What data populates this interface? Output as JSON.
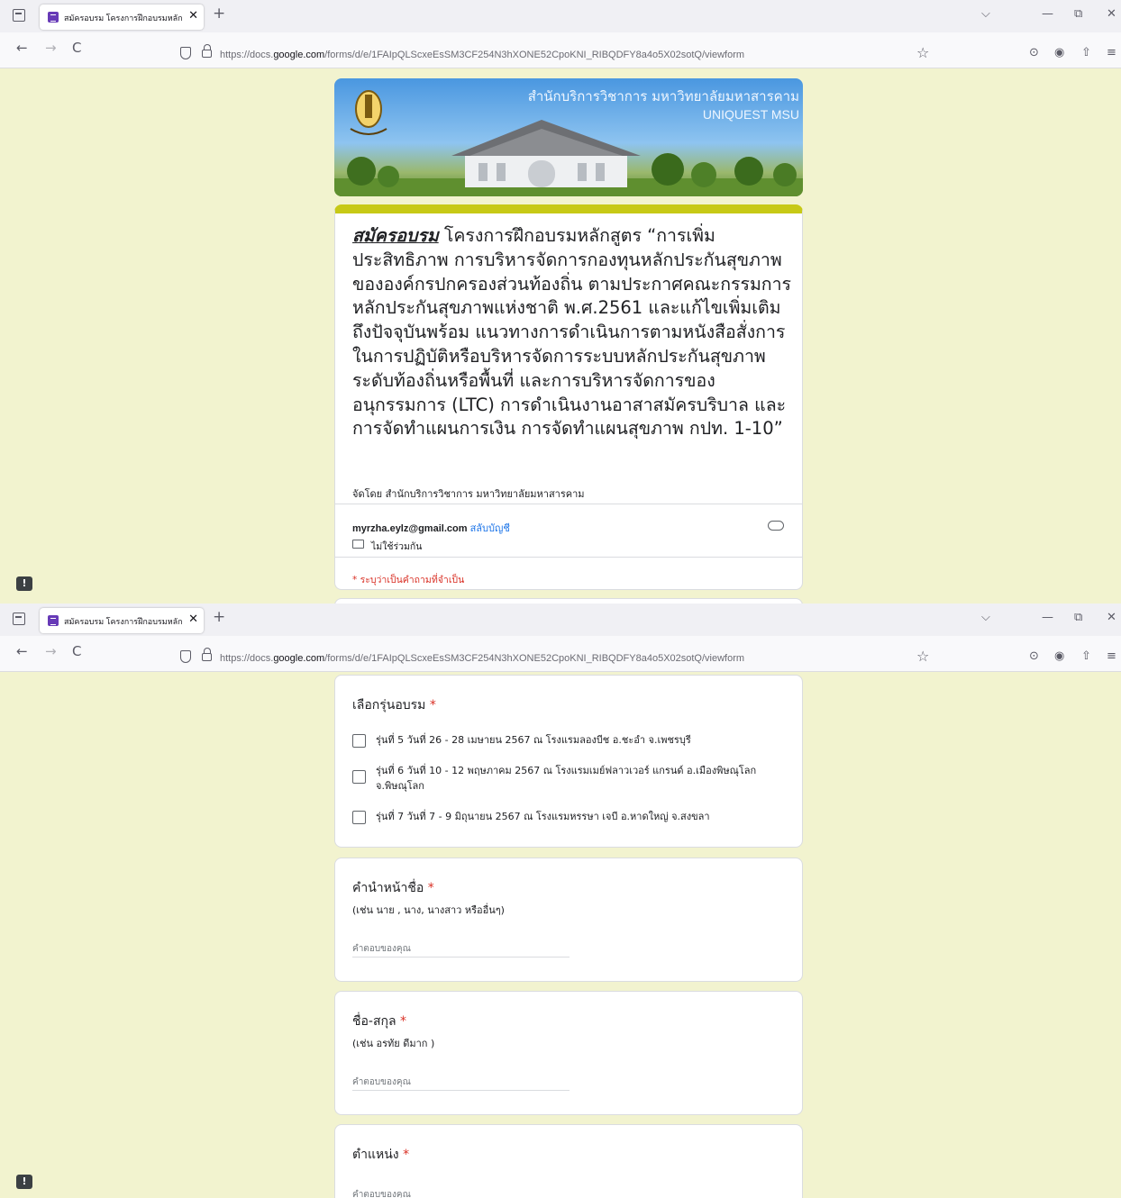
{
  "browser": {
    "tab_title": "สมัครอบรม โครงการฝึกอบรมหลักสู",
    "tab_close": "✕",
    "new_tab": "+",
    "url_prefix": "https://docs.",
    "url_host": "google.com",
    "url_path": "/forms/d/e/1FAIpQLScxeEsSM3CF254N3hXONE52CpoKNI_RIBQDFY8a4o5X02sotQ/viewform",
    "icons": [
      "tab-list-icon",
      "back-icon",
      "forward-icon",
      "reload-icon",
      "shield-icon",
      "lock-icon",
      "bookmark-star-icon",
      "pocket-icon",
      "account-icon",
      "extensions-icon",
      "menu-icon",
      "chevron-down-icon",
      "minimize-icon",
      "restore-icon",
      "close-icon"
    ],
    "glyphs": {
      "back": "←",
      "forward": "→",
      "reload": "C",
      "star": "☆",
      "chevron": "⌵",
      "minimize": "—",
      "restore": "⧉",
      "close": "✕",
      "pocket": "⊙",
      "account": "◉",
      "extensions": "⇧",
      "menu": "≡",
      "feedback": "!"
    }
  },
  "banner": {
    "title": "สำนักบริการวิชาการ มหาวิทยาลัยมหาสารคาม",
    "subtitle": "UNIQUEST MSU",
    "seal_text": "มหาวิทยาลัยมหาสารคาม"
  },
  "form": {
    "title_bold": "สมัครอบรม",
    "title_rest": " โครงการฝึกอบรมหลักสูตร “การเพิ่มประสิทธิภาพ การบริหารจัดการกองทุนหลักประกันสุขภาพขององค์กรปกครองส่วนท้องถิ่น ตามประกาศคณะกรรมการหลักประกันสุขภาพแห่งชาติ พ.ศ.2561 และแก้ไขเพิ่มเติมถึงปัจจุบันพร้อม แนวทางการดำเนินการตามหนังสือสั่งการในการปฏิบัติหรือบริหารจัดการระบบหลักประกันสุขภาพ ระดับท้องถิ่นหรือพื้นที่ และการบริหารจัดการของอนุกรรมการ (LTC) การดำเนินงานอาสาสมัครบริบาล และการจัดทำแผนการเงิน การจัดทำแผนสุขภาพ กปท. 1-10”",
    "organizer": "จัดโดย สำนักบริการวิชาการ  มหาวิทยาลัยมหาสารคาม",
    "email": "myrzha.eylz@gmail.com",
    "switch_account": "สลับบัญชี",
    "not_shared": "ไม่ใช้ร่วมกัน",
    "required_note": "* ระบุว่าเป็นคำถามที่จำเป็น"
  },
  "questions": {
    "batch": {
      "title": "เลือกรุ่นอบรม",
      "required_mark": "*",
      "options": [
        "รุ่นที่ 5 วันที่ 26 - 28 เมษายน 2567 ณ โรงแรมลองบีช อ.ชะอำ จ.เพชรบุรี",
        "รุ่นที่ 6 วันที่ 10 - 12 พฤษภาคม 2567 ณ โรงแรมเมย์ฟลาวเวอร์ แกรนด์ อ.เมืองพิษณุโลก จ.พิษณุโลก",
        "รุ่นที่ 7 วันที่ 7 - 9 มิถุนายน 2567 ณ โรงแรมหรรษา เจบี อ.หาดใหญ่ จ.สงขลา"
      ]
    },
    "prefix": {
      "title": "คำนำหน้าชื่อ",
      "required_mark": "*",
      "hint": "(เช่น นาย , นาง, นางสาว หรืออื่นๆ)",
      "placeholder": "คำตอบของคุณ"
    },
    "fullname": {
      "title": "ชื่อ-สกุล",
      "required_mark": "*",
      "hint": "(เช่น อรทัย ดีมาก )",
      "placeholder": "คำตอบของคุณ"
    },
    "position": {
      "title": "ตำแหน่ง",
      "required_mark": "*",
      "placeholder": "คำตอบของคุณ"
    }
  },
  "colors": {
    "page_bg": "#f2f3cf",
    "header_accent": "#c7c916",
    "required": "#d93025",
    "link": "#1a73e8",
    "form_purple": "#673ab7"
  }
}
